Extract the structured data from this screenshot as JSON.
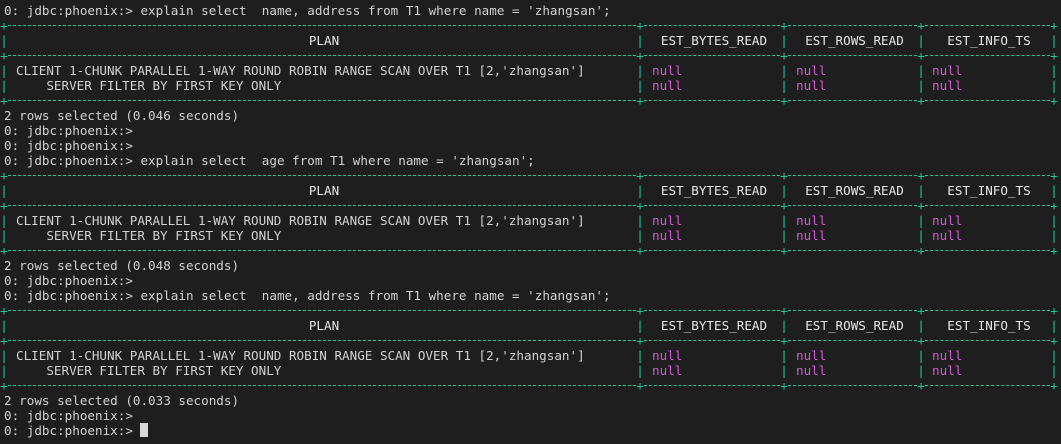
{
  "colors": {
    "background": "#1e1e1e",
    "text": "#d2d2d2",
    "border": "#1fc79a",
    "null_value": "#d05ad0"
  },
  "blocks": [
    {
      "prompt": "0: jdbc:phoenix:> explain select  name, address from T1 where name = 'zhangsan';",
      "headers": [
        "PLAN",
        "EST_BYTES_READ",
        "EST_ROWS_READ",
        "EST_INFO_TS"
      ],
      "rows": [
        [
          "CLIENT 1-CHUNK PARALLEL 1-WAY ROUND ROBIN RANGE SCAN OVER T1 [2,'zhangsan']",
          "null",
          "null",
          "null"
        ],
        [
          "    SERVER FILTER BY FIRST KEY ONLY",
          "null",
          "null",
          "null"
        ]
      ],
      "result": "2 rows selected (0.046 seconds)",
      "after": [
        "0: jdbc:phoenix:>",
        "0: jdbc:phoenix:>"
      ]
    },
    {
      "prompt": "0: jdbc:phoenix:> explain select  age from T1 where name = 'zhangsan';",
      "headers": [
        "PLAN",
        "EST_BYTES_READ",
        "EST_ROWS_READ",
        "EST_INFO_TS"
      ],
      "rows": [
        [
          "CLIENT 1-CHUNK PARALLEL 1-WAY ROUND ROBIN RANGE SCAN OVER T1 [2,'zhangsan']",
          "null",
          "null",
          "null"
        ],
        [
          "    SERVER FILTER BY FIRST KEY ONLY",
          "null",
          "null",
          "null"
        ]
      ],
      "result": "2 rows selected (0.048 seconds)",
      "after": [
        "0: jdbc:phoenix:>"
      ]
    },
    {
      "prompt": "0: jdbc:phoenix:> explain select  name, address from T1 where name = 'zhangsan';",
      "headers": [
        "PLAN",
        "EST_BYTES_READ",
        "EST_ROWS_READ",
        "EST_INFO_TS"
      ],
      "rows": [
        [
          "CLIENT 1-CHUNK PARALLEL 1-WAY ROUND ROBIN RANGE SCAN OVER T1 [2,'zhangsan']",
          "null",
          "null",
          "null"
        ],
        [
          "    SERVER FILTER BY FIRST KEY ONLY",
          "null",
          "null",
          "null"
        ]
      ],
      "result": "2 rows selected (0.033 seconds)",
      "after": [
        "0: jdbc:phoenix:>"
      ]
    }
  ],
  "final_prompt": "0: jdbc:phoenix:> "
}
